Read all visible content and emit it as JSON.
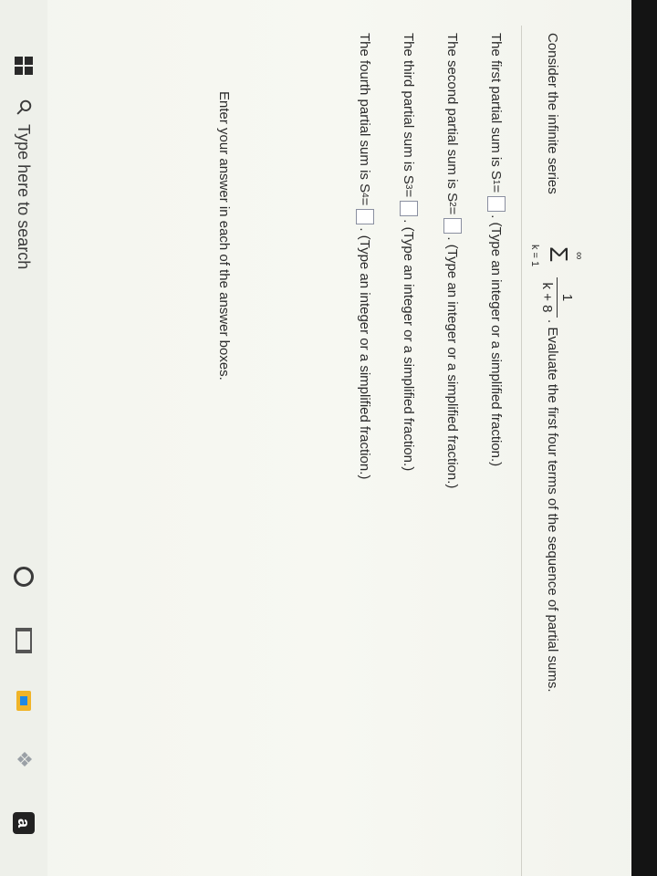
{
  "question": {
    "intro": "Consider the infinite series",
    "sigma_symbol": "Σ",
    "sigma_upper": "∞",
    "sigma_lower": "k = 1",
    "fraction_numerator": "1",
    "fraction_denominator": "k + 8",
    "instruction_tail": ". Evaluate the first four terms of the sequence of partial sums."
  },
  "partial_sums": [
    {
      "lead": "The first partial sum is S",
      "sub": "1",
      "eq": " =",
      "hint": ". (Type an integer or a simplified fraction.)",
      "value": ""
    },
    {
      "lead": "The second partial sum is S",
      "sub": "2",
      "eq": " =",
      "hint": ". (Type an integer or a simplified fraction.)",
      "value": ""
    },
    {
      "lead": "The third partial sum is S",
      "sub": "3",
      "eq": " =",
      "hint": ". (Type an integer or a simplified fraction.)",
      "value": ""
    },
    {
      "lead": "The fourth partial sum is S",
      "sub": "4",
      "eq": " =",
      "hint": ". (Type an integer or a simplified fraction.)",
      "value": ""
    }
  ],
  "footer_instruction": "Enter your answer in each of the answer boxes.",
  "taskbar": {
    "search_placeholder": "Type here to search",
    "icons": [
      "windows-start-icon",
      "search-icon",
      "cortana-icon",
      "task-view-icon",
      "file-explorer-icon",
      "dropbox-icon",
      "amazon-icon"
    ],
    "amazon_letter": "a"
  }
}
